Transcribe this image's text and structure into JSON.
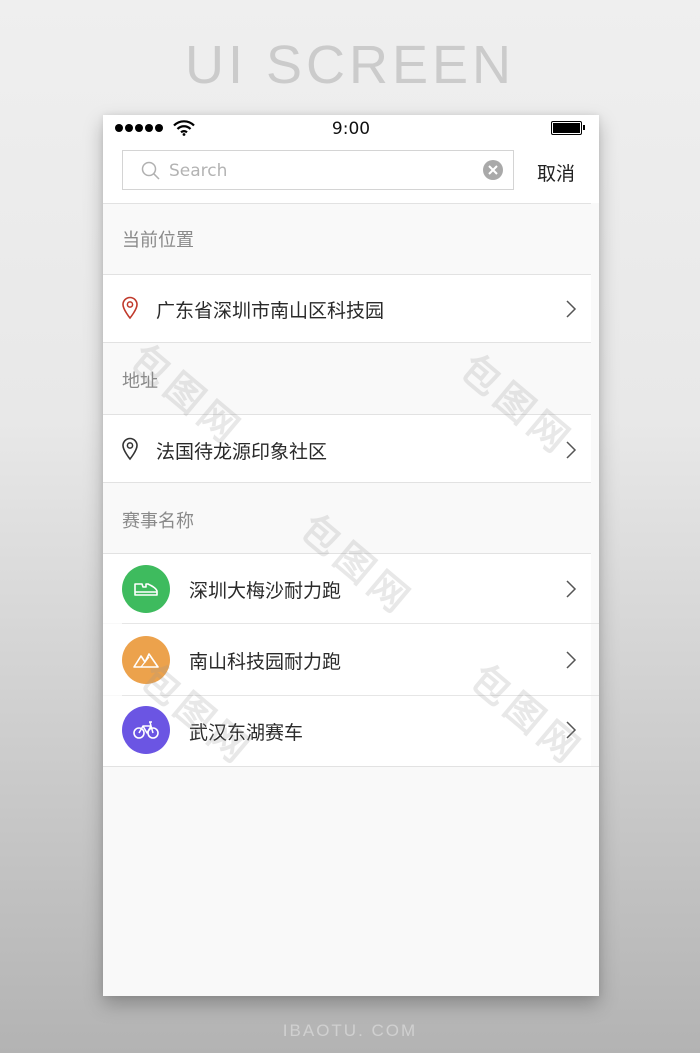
{
  "page": {
    "hero_title": "UI SCREEN",
    "footer_brand": "IBAOTU. COM",
    "watermark_text": "包图网"
  },
  "status_bar": {
    "time": "9:00",
    "signal_bars": 5
  },
  "search": {
    "placeholder": "Search",
    "value": "",
    "cancel_label": "取消"
  },
  "sections": {
    "current_location": {
      "header": "当前位置",
      "item": {
        "label": "广东省深圳市南山区科技园",
        "icon": "map-pin-icon",
        "icon_color": "#c0392b"
      }
    },
    "address": {
      "header": "地址",
      "item": {
        "label": "法国待龙源印象社区",
        "icon": "map-pin-icon",
        "icon_color": "#333333"
      }
    },
    "events": {
      "header": "赛事名称",
      "items": [
        {
          "label": "深圳大梅沙耐力跑",
          "icon": "sneaker-icon",
          "color": "#3ebb5e"
        },
        {
          "label": "南山科技园耐力跑",
          "icon": "mountain-icon",
          "color": "#eca24c"
        },
        {
          "label": "武汉东湖赛车",
          "icon": "bicycle-icon",
          "color": "#6b55e3"
        }
      ]
    }
  }
}
